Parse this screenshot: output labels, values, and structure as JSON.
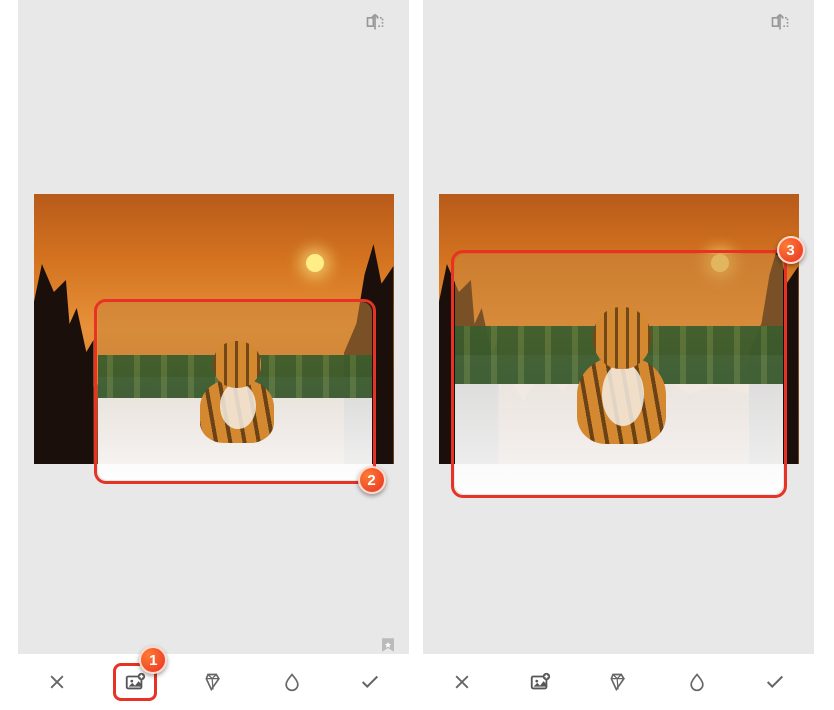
{
  "annotations": {
    "a1": "1",
    "a2": "2",
    "a3": "3"
  },
  "icons": {
    "compare": "compare",
    "close": "close",
    "addImage": "add-image",
    "style": "style",
    "drop": "drop",
    "check": "check",
    "bookmark": "bookmark"
  }
}
